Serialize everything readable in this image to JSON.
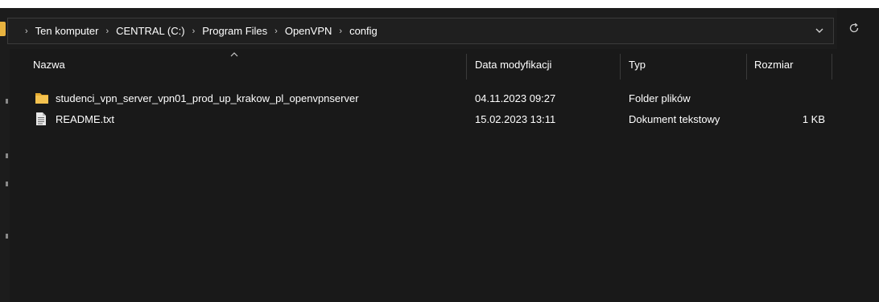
{
  "addressbar": {
    "crumbs": [
      "Ten komputer",
      "CENTRAL (C:)",
      "Program Files",
      "OpenVPN",
      "config"
    ],
    "separator": "›",
    "dropdown_icon": "chevron-down-icon",
    "refresh_icon": "refresh-icon"
  },
  "columns": {
    "name": "Nazwa",
    "date": "Data modyfikacji",
    "type": "Typ",
    "size": "Rozmiar"
  },
  "files": [
    {
      "name": "studenci_vpn_server_vpn01_prod_up_krakow_pl_openvpnserver",
      "date": "04.11.2023 09:27",
      "type": "Folder plików",
      "size": "",
      "icon": "folder-icon"
    },
    {
      "name": "README.txt",
      "date": "15.02.2023 13:11",
      "type": "Dokument tekstowy",
      "size": "1 KB",
      "icon": "text-file-icon"
    }
  ],
  "colors": {
    "background": "#191919",
    "folder": "#e8b33f"
  }
}
